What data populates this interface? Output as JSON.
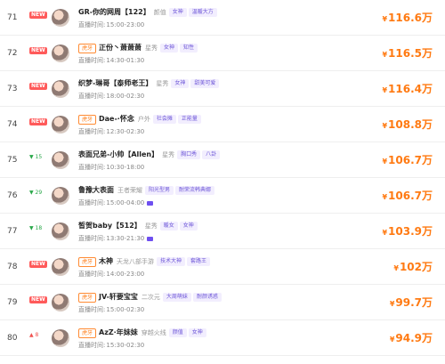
{
  "rows": [
    {
      "rank": "71",
      "trend": {
        "type": "new",
        "label": "NEW"
      },
      "badge": "",
      "name": "GR-你的网周【122】",
      "category": "颜值",
      "tags": [
        "女神",
        "温暖大方"
      ],
      "time_label": "直播时间:",
      "time": "15:00-23:00",
      "price": "116.6万",
      "show_live_icon": false
    },
    {
      "rank": "72",
      "trend": {
        "type": "new",
        "label": "NEW"
      },
      "badge": "虎牙",
      "name": "正份丶萧萧萧",
      "category": "星秀",
      "tags": [
        "女神",
        "知性"
      ],
      "time_label": "直播时间:",
      "time": "14:30-01:30",
      "price": "116.5万",
      "show_live_icon": false
    },
    {
      "rank": "73",
      "trend": {
        "type": "new",
        "label": "NEW"
      },
      "badge": "",
      "name": "织梦-琳哥【泰师老王】",
      "category": "星秀",
      "tags": [
        "女神",
        "甜美可爱"
      ],
      "time_label": "直播时间:",
      "time": "18:00-02:30",
      "price": "116.4万",
      "show_live_icon": false
    },
    {
      "rank": "74",
      "trend": {
        "type": "new",
        "label": "NEW"
      },
      "badge": "虎牙",
      "name": "Dae-·怀念",
      "category": "户外",
      "tags": [
        "社会摊",
        "正能量"
      ],
      "time_label": "直播时间:",
      "time": "12:30-02:30",
      "price": "108.8万",
      "show_live_icon": false
    },
    {
      "rank": "75",
      "trend": {
        "type": "down",
        "label": "▼ 15"
      },
      "badge": "",
      "name": "表面兄弟-小帅【Allen】",
      "category": "星秀",
      "tags": [
        "胸口秀",
        "八卦"
      ],
      "time_label": "直播时间:",
      "time": "10:30-18:00",
      "price": "106.7万",
      "show_live_icon": false
    },
    {
      "rank": "76",
      "trend": {
        "type": "down",
        "label": "▼ 29"
      },
      "badge": "",
      "name": "鲁豫大表面",
      "category": "王者荣耀",
      "tags": [
        "阳光型男",
        "耐荣流韩典娜"
      ],
      "time_label": "直播时间:",
      "time": "15:00-04:00",
      "price": "106.7万",
      "show_live_icon": true
    },
    {
      "rank": "77",
      "trend": {
        "type": "down",
        "label": "▼ 18"
      },
      "badge": "",
      "name": "皙贺baby【512】",
      "category": "星秀",
      "tags": [
        "暖女",
        "女神"
      ],
      "time_label": "直播时间:",
      "time": "13:30-21:30",
      "price": "103.9万",
      "show_live_icon": true
    },
    {
      "rank": "78",
      "trend": {
        "type": "new",
        "label": "NEW"
      },
      "badge": "虎牙",
      "name": "木神",
      "category": "天龙八部手游",
      "tags": [
        "技术大神",
        "套路王"
      ],
      "time_label": "直播时间:",
      "time": "14:00-23:00",
      "price": "102万",
      "show_live_icon": false
    },
    {
      "rank": "79",
      "trend": {
        "type": "new",
        "label": "NEW"
      },
      "badge": "虎牙",
      "name": "JV-轩要宝宝",
      "category": "二次元",
      "tags": [
        "大周萌妹",
        "耐颜诱惑"
      ],
      "time_label": "直播时间:",
      "time": "15:00-02:30",
      "price": "99.7万",
      "show_live_icon": false
    },
    {
      "rank": "80",
      "trend": {
        "type": "up",
        "label": "▲ 8"
      },
      "badge": "虎牙",
      "name": "AzZ·年妹妹",
      "category": "穿越火线",
      "tags": [
        "颜值",
        "女神"
      ],
      "time_label": "直播时间:",
      "time": "15:30-02:30",
      "price": "94.9万",
      "show_live_icon": false
    }
  ],
  "currency_symbol": "¥"
}
